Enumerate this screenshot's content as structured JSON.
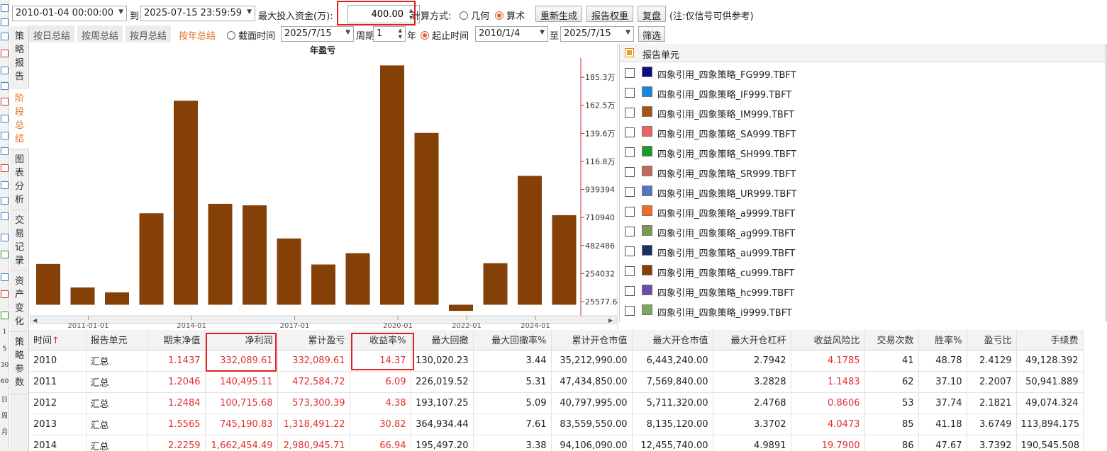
{
  "toolbar": {
    "start_datetime": "2010-01-04 00:00:00",
    "to_label": "到",
    "end_datetime": "2025-07-15 23:59:59",
    "max_capital_label": "最大投入资金(万):",
    "max_capital_value": "400.00",
    "calc_label": "计算方式:",
    "geometric_label": "几何",
    "arithmetic_label": "算术",
    "regenerate_label": "重新生成",
    "report_weight_label": "报告权重",
    "replay_label": "复盘",
    "note": "(注:仅信号可供参考)"
  },
  "vtabs": [
    {
      "label": "策略报告"
    },
    {
      "label": "阶段总结"
    },
    {
      "label": "图表分析"
    },
    {
      "label": "交易记录"
    },
    {
      "label": "资产变化"
    },
    {
      "label": "策略参数"
    }
  ],
  "subbar": {
    "tabs": [
      "按日总结",
      "按周总结",
      "按月总结",
      "按年总结"
    ],
    "cutoff_label": "截面时间",
    "cutoff_value": "2025/7/15",
    "period_label": "周期",
    "period_value": "1",
    "year_label": "年",
    "start_label": "起止时间",
    "start_value": "2010/1/4",
    "to_label": "至",
    "end_value": "2025/7/15",
    "filter_label": "筛选"
  },
  "legend": {
    "header": "报告单元",
    "items": [
      {
        "name": "四象引用_四象策略_FG999.TBFT",
        "color": "#0d0d80"
      },
      {
        "name": "四象引用_四象策略_IF999.TBFT",
        "color": "#1a86d8"
      },
      {
        "name": "四象引用_四象策略_IM999.TBFT",
        "color": "#a65410"
      },
      {
        "name": "四象引用_四象策略_SA999.TBFT",
        "color": "#f06060"
      },
      {
        "name": "四象引用_四象策略_SH999.TBFT",
        "color": "#1a9a2a"
      },
      {
        "name": "四象引用_四象策略_SR999.TBFT",
        "color": "#c06a5a"
      },
      {
        "name": "四象引用_四象策略_UR999.TBFT",
        "color": "#4f78c0"
      },
      {
        "name": "四象引用_四象策略_a9999.TBFT",
        "color": "#f06a28"
      },
      {
        "name": "四象引用_四象策略_ag999.TBFT",
        "color": "#7a9a50"
      },
      {
        "name": "四象引用_四象策略_au999.TBFT",
        "color": "#17306a"
      },
      {
        "name": "四象引用_四象策略_cu999.TBFT",
        "color": "#854008"
      },
      {
        "name": "四象引用_四象策略_hc999.TBFT",
        "color": "#6a4ea8"
      },
      {
        "name": "四象引用_四象策略_i9999.TBFT",
        "color": "#7aa860"
      }
    ]
  },
  "chart_data": {
    "type": "bar",
    "title": "年盈亏",
    "bar_color": "#854008",
    "categories": [
      "2010",
      "2011",
      "2012",
      "2013",
      "2014",
      "2015",
      "2016",
      "2017",
      "2018",
      "2019",
      "2020",
      "2021",
      "2022",
      "2023",
      "2024",
      "2025"
    ],
    "values": [
      332090,
      140495,
      100716,
      745191,
      1662454,
      822000,
      810000,
      540000,
      328000,
      420000,
      1950000,
      1400000,
      -50000,
      338000,
      1050000,
      730000
    ],
    "x_tick_labels": [
      "2011-01-01",
      "2014-01",
      "2017-01",
      "2020-01",
      "2022-01",
      "2024-01"
    ],
    "x_tick_positions": [
      "2011",
      "2014",
      "2017",
      "2020",
      "2022",
      "2024"
    ],
    "y_tick_labels": [
      "185.3万",
      "162.5万",
      "139.6万",
      "116.8万",
      "939394",
      "710940",
      "482486",
      "254032",
      "25577.6"
    ],
    "y_tick_values": [
      1853000,
      1625000,
      1396000,
      1168000,
      939394,
      710940,
      482486,
      254032,
      25577.6
    ],
    "ylim": [
      -90000,
      2010000
    ],
    "y_axis_side": "right",
    "grid": false
  },
  "table": {
    "columns": [
      "时间",
      "报告单元",
      "期末净值",
      "净利润",
      "累计盈亏",
      "收益率%",
      "最大回撤",
      "最大回撤率%",
      "累计开仓市值",
      "最大开仓市值",
      "最大开仓杠杆",
      "收益风险比",
      "交易次数",
      "胜率%",
      "盈亏比",
      "手续费"
    ],
    "sort_arrow": "↑",
    "rows": [
      [
        "2010",
        "汇总",
        "1.1437",
        "332,089.61",
        "332,089.61",
        "14.37",
        "130,020.23",
        "3.44",
        "35,212,990.00",
        "6,443,240.00",
        "2.7942",
        "4.1785",
        "41",
        "48.78",
        "2.4129",
        "49,128.392"
      ],
      [
        "2011",
        "汇总",
        "1.2046",
        "140,495.11",
        "472,584.72",
        "6.09",
        "226,019.52",
        "5.31",
        "47,434,850.00",
        "7,569,840.00",
        "3.2828",
        "1.1483",
        "62",
        "37.10",
        "2.2007",
        "50,941.889"
      ],
      [
        "2012",
        "汇总",
        "1.2484",
        "100,715.68",
        "573,300.39",
        "4.38",
        "193,107.25",
        "5.09",
        "40,797,995.00",
        "5,711,320.00",
        "2.4768",
        "0.8606",
        "53",
        "37.74",
        "2.1821",
        "49,074.324"
      ],
      [
        "2013",
        "汇总",
        "1.5565",
        "745,190.83",
        "1,318,491.22",
        "30.82",
        "364,934.44",
        "7.61",
        "83,559,550.00",
        "8,135,120.00",
        "3.3702",
        "4.0473",
        "85",
        "41.18",
        "3.6749",
        "113,894.175"
      ],
      [
        "2014",
        "汇总",
        "2.2259",
        "1,662,454.49",
        "2,980,945.71",
        "66.94",
        "195,497.20",
        "3.38",
        "94,106,090.00",
        "12,455,740.00",
        "4.9891",
        "19.7900",
        "86",
        "47.67",
        "3.7392",
        "190,545.508"
      ]
    ]
  },
  "sidebar_numbers": [
    "1",
    "5",
    "30",
    "60",
    "日",
    "周",
    "月"
  ]
}
